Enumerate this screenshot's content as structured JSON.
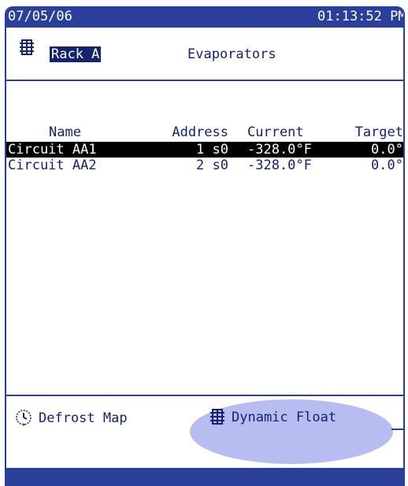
{
  "status": {
    "date": "07/05/06",
    "time": "01:13:52 PM"
  },
  "header": {
    "rack": "Rack A",
    "title": "Evaporators"
  },
  "table": {
    "columns": {
      "name": "Name",
      "address": "Address",
      "current": "Current",
      "target": "Target"
    },
    "rows": [
      {
        "name": "Circuit AA1",
        "address": "1 s0",
        "current": "-328.0°F",
        "target": "0.0°"
      },
      {
        "name": "Circuit AA2",
        "address": "2 s0",
        "current": "-328.0°F",
        "target": "0.0°"
      }
    ]
  },
  "menu": {
    "defrost": "Defrost Map",
    "dynamic": "Dynamic Float"
  },
  "icons": {
    "rack": "rack-grid-icon",
    "defrost": "clock-icon",
    "dynamic": "rack-grid-icon"
  },
  "colors": {
    "bar": "#2a3f9a",
    "highlight": "#b7bdf0",
    "selected_row": "#000000",
    "text": "#15226e"
  }
}
